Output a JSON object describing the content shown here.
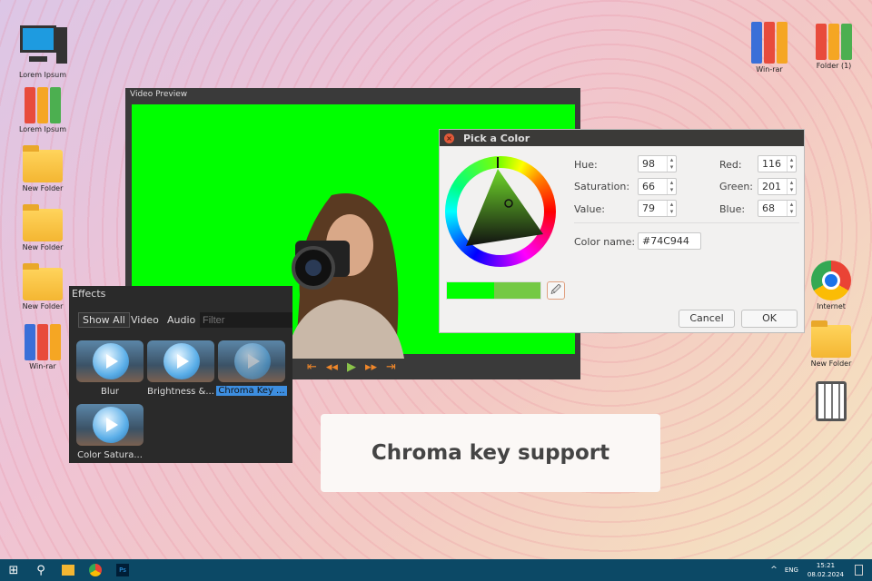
{
  "desktop": {
    "left_icons": [
      "Lorem Ipsum",
      "Lorem Ipsum",
      "New Folder",
      "New Folder",
      "New Folder",
      "Win-rar"
    ],
    "right_icons": [
      "Win-rar",
      "Folder (1)",
      "Internet",
      "New Folder"
    ]
  },
  "video_preview": {
    "title": "Video Preview",
    "controls": [
      "⇤",
      "◂◂",
      "▶",
      "▸▸",
      "⇥"
    ]
  },
  "color_picker": {
    "title": "Pick a Color",
    "hue_label": "Hue:",
    "hue": "98",
    "sat_label": "Saturation:",
    "sat": "66",
    "val_label": "Value:",
    "val": "79",
    "red_label": "Red:",
    "red": "116",
    "green_label": "Green:",
    "green": "201",
    "blue_label": "Blue:",
    "blue": "68",
    "name_label": "Color name:",
    "name": "#74C944",
    "cancel": "Cancel",
    "ok": "OK",
    "old_color": "#00ff00",
    "new_color": "#74c944"
  },
  "effects": {
    "title": "Effects",
    "tabs": [
      "Show All",
      "Video",
      "Audio"
    ],
    "filter_placeholder": "Filter",
    "items": [
      "Blur",
      "Brightness &...",
      "Chroma Key ...",
      "Color Satura..."
    ]
  },
  "caption": "Chroma key support",
  "taskbar": {
    "lang": "ENG",
    "time": "15:21",
    "date": "08.02.2024"
  }
}
